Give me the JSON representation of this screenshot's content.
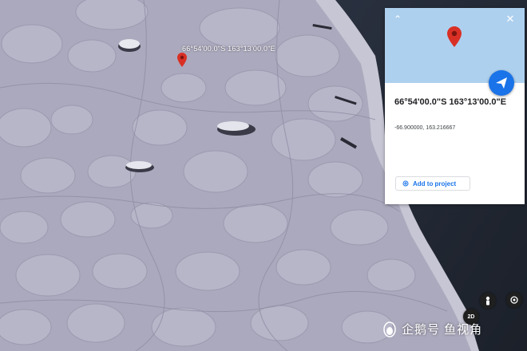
{
  "map": {
    "marker_label": "66°54'00.0\"S 163°13'00.0\"E",
    "terrain": "sea-ice floes with dark ocean water on the right"
  },
  "panel": {
    "coordinates_dms": "66°54'00.0\"S 163°13'00.0\"E",
    "coordinates_decimal": "-66.900000, 163.216667",
    "add_to_project_label": "Add to project",
    "header_color": "#aed0ef",
    "accent_color": "#1a73e8",
    "pin_color": "#d93025"
  },
  "controls": {
    "view_mode_label": "2D"
  },
  "watermark": {
    "text": "企鹅号 鱼视角"
  }
}
